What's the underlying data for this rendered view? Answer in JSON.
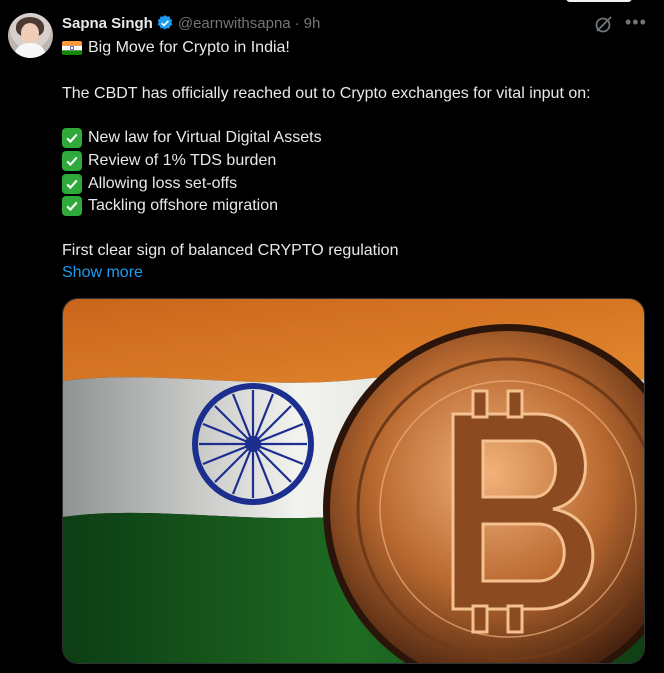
{
  "tweet": {
    "author_name": "Sapna Singh",
    "author_handle": "@earnwithsapna",
    "separator": "·",
    "time": "9h",
    "headline": "Big Move for Crypto in India!",
    "intro": "The CBDT has officially reached out to Crypto exchanges for vital input on:",
    "points": [
      "New law for Virtual Digital Assets",
      "Review of 1% TDS burden",
      "Allowing loss set-offs",
      "Tackling offshore migration"
    ],
    "closing": "First clear sign of balanced CRYPTO regulation",
    "show_more": "Show more"
  },
  "icons": {
    "verified": "verified-badge-icon",
    "grok": "grok-icon",
    "more": "more-icon",
    "flag": "india-flag-emoji",
    "check": "check-mark-emoji"
  },
  "colors": {
    "background": "#000000",
    "text": "#e7e9ea",
    "secondary": "#71767b",
    "link": "#1d9bf0",
    "check": "#2eaa3a"
  }
}
